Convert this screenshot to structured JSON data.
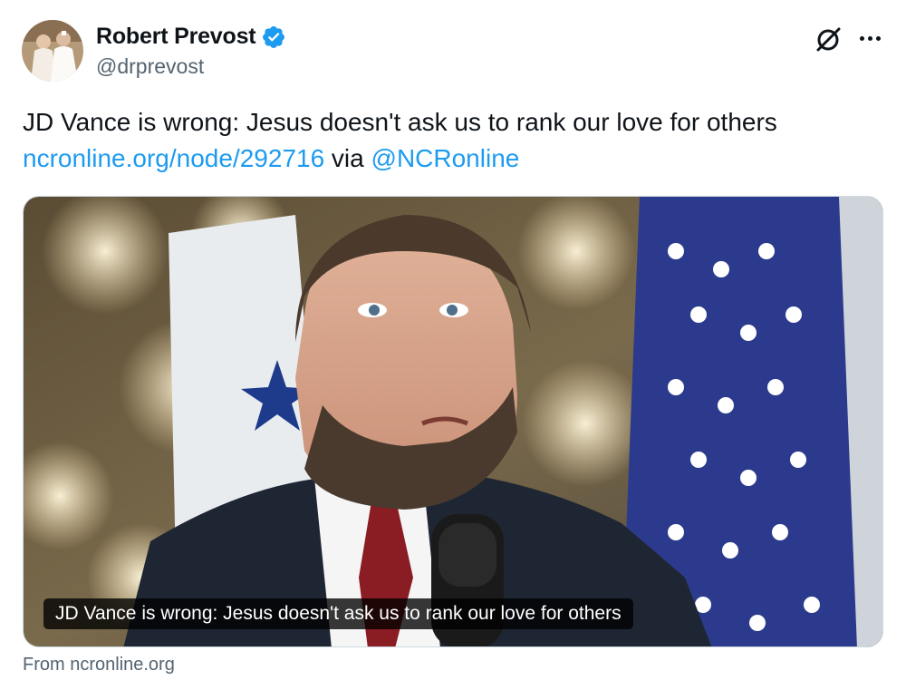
{
  "author": {
    "display_name": "Robert Prevost",
    "handle": "@drprevost",
    "verified": true,
    "verified_color": "#1d9bf0"
  },
  "tweet": {
    "text": "JD Vance is wrong: Jesus doesn't ask us to rank our love for others",
    "link": "ncronline.org/node/292716",
    "via": " via ",
    "mention": "@NCRonline",
    "link_color": "#1d9bf0"
  },
  "card": {
    "image_icon": "photo-of-speaker-at-podium",
    "caption": "JD Vance is wrong: Jesus doesn't ask us to rank our love for others",
    "source": "From ncronline.org"
  },
  "actions": {
    "grok_icon": "grok-icon",
    "more_icon": "more-icon"
  }
}
